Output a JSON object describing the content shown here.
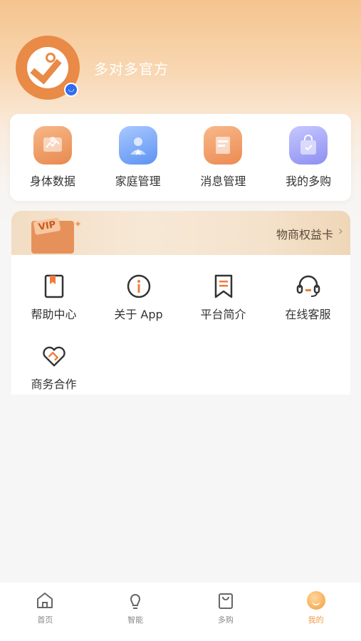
{
  "profile": {
    "nickname": "多对多官方"
  },
  "quick_actions": [
    {
      "label": "身体数据",
      "icon": "body-data-icon"
    },
    {
      "label": "家庭管理",
      "icon": "family-icon"
    },
    {
      "label": "消息管理",
      "icon": "message-icon"
    },
    {
      "label": "我的多购",
      "icon": "shopping-bag-icon"
    }
  ],
  "vip": {
    "tag": "VIP",
    "label": "物商权益卡"
  },
  "services": [
    {
      "label": "帮助中心",
      "icon": "help-book-icon"
    },
    {
      "label": "关于 App",
      "icon": "info-icon"
    },
    {
      "label": "平台简介",
      "icon": "bookmark-icon"
    },
    {
      "label": "在线客服",
      "icon": "headset-icon"
    },
    {
      "label": "商务合作",
      "icon": "handshake-heart-icon"
    }
  ],
  "tabbar": [
    {
      "label": "首页",
      "icon": "home-icon"
    },
    {
      "label": "智能",
      "icon": "bulb-icon"
    },
    {
      "label": "多购",
      "icon": "bag-icon"
    },
    {
      "label": "我的",
      "icon": "me-icon",
      "active": true
    }
  ],
  "colors": {
    "accent": "#ef9a4a",
    "badge_blue": "#2f6cf0"
  }
}
